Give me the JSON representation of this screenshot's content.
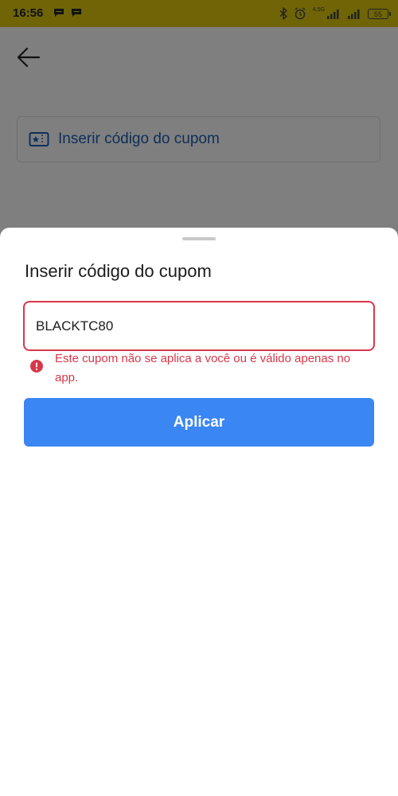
{
  "status_bar": {
    "time": "16:56",
    "network_label": "4.5G",
    "battery_level": "55",
    "icons": [
      "message-icon",
      "message-icon",
      "bluetooth-icon",
      "alarm-icon",
      "signal-icon",
      "signal-icon",
      "battery-icon"
    ]
  },
  "background_page": {
    "back_icon": "arrow-left-icon",
    "coupon_entry_label": "Inserir código do cupom",
    "coupon_entry_icon": "ticket-star-icon"
  },
  "sheet": {
    "title": "Inserir código do cupom",
    "code_input": {
      "value": "BLACKTC80",
      "placeholder": ""
    },
    "error": {
      "icon": "error-icon",
      "message": "Este cupom não se aplica a você ou é válido apenas no app."
    },
    "apply_label": "Aplicar"
  },
  "colors": {
    "error": "#d8374a",
    "primary": "#3a86f3",
    "link": "#1e5fb4",
    "status_bar": "#6f6406"
  }
}
